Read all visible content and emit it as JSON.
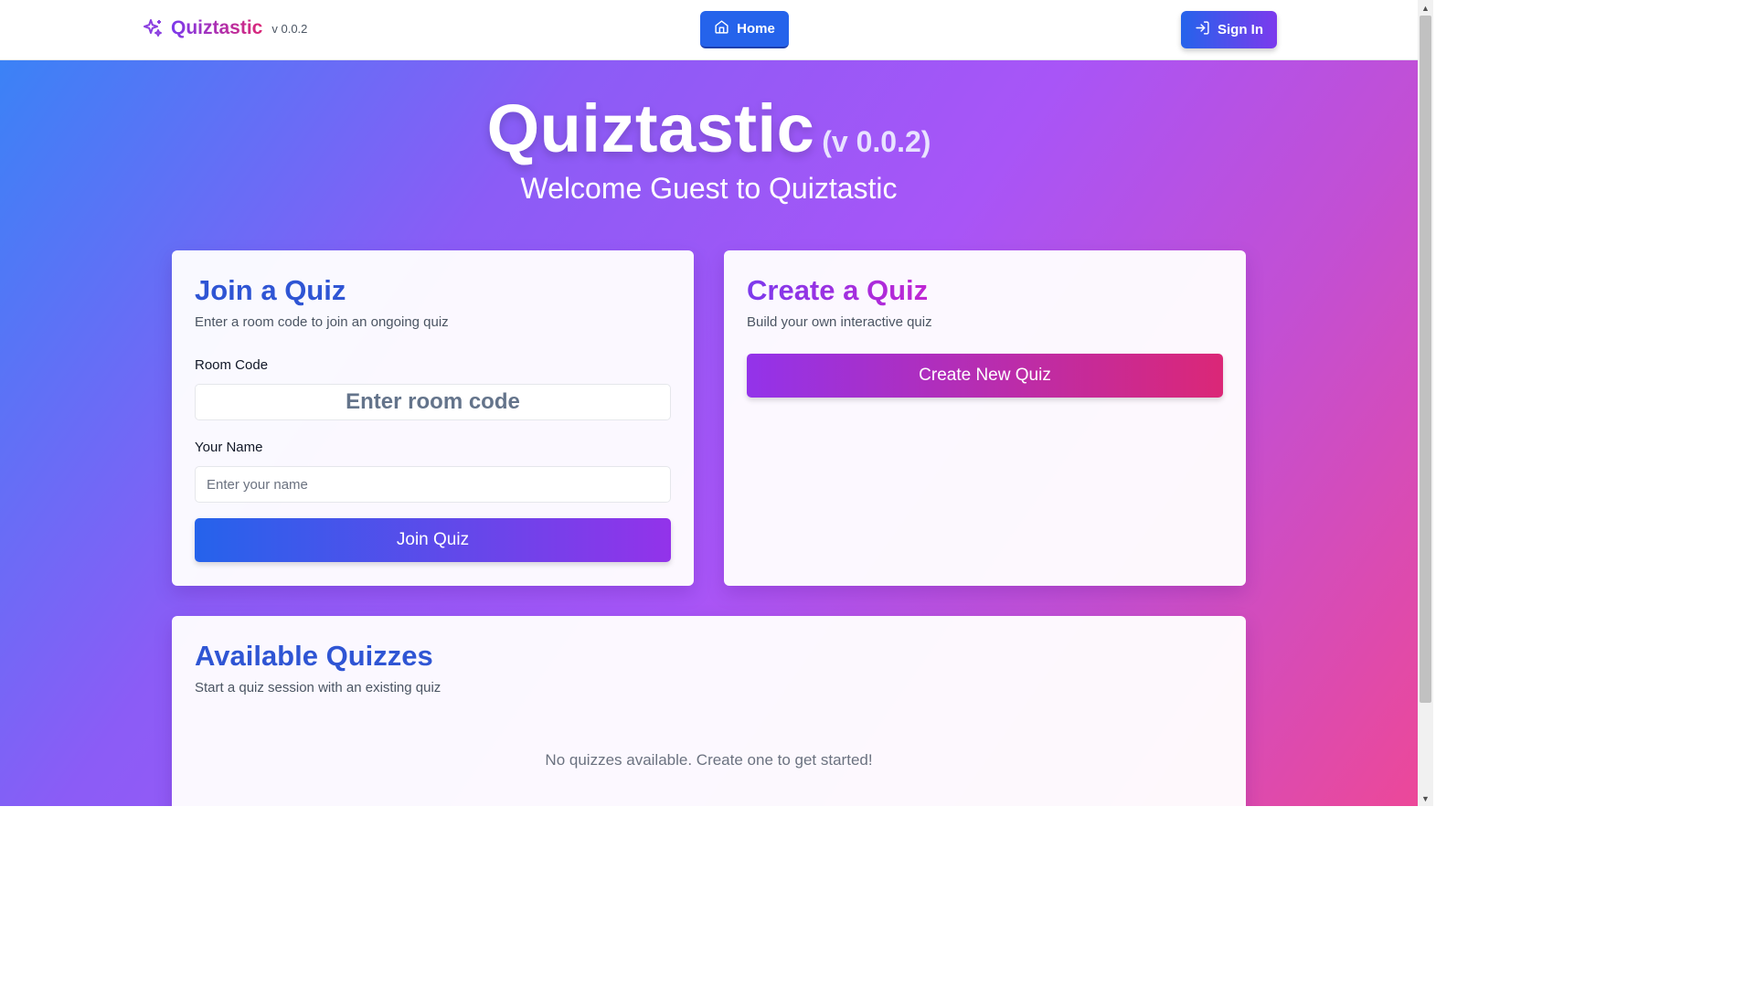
{
  "header": {
    "brand_name": "Quiztastic",
    "brand_version": "v 0.0.2",
    "nav_home": "Home",
    "sign_in": "Sign In"
  },
  "hero": {
    "title": "Quiztastic",
    "title_version": "(v 0.0.2)",
    "welcome": "Welcome Guest to Quiztastic"
  },
  "join_card": {
    "title": "Join a Quiz",
    "subtitle": "Enter a room code to join an ongoing quiz",
    "room_code_label": "Room Code",
    "room_code_placeholder": "Enter room code",
    "name_label": "Your Name",
    "name_placeholder": "Enter your name",
    "button": "Join Quiz"
  },
  "create_card": {
    "title": "Create a Quiz",
    "subtitle": "Build your own interactive quiz",
    "button": "Create New Quiz"
  },
  "available_card": {
    "title": "Available Quizzes",
    "subtitle": "Start a quiz session with an existing quiz",
    "empty_message": "No quizzes available. Create one to get started!"
  },
  "colors": {
    "primary_blue": "#2563eb",
    "accent_purple": "#7c3aed",
    "accent_pink": "#db2777"
  },
  "icons": {
    "brand": "sparkles-icon",
    "home": "home-icon",
    "sign_in": "log-in-icon"
  }
}
